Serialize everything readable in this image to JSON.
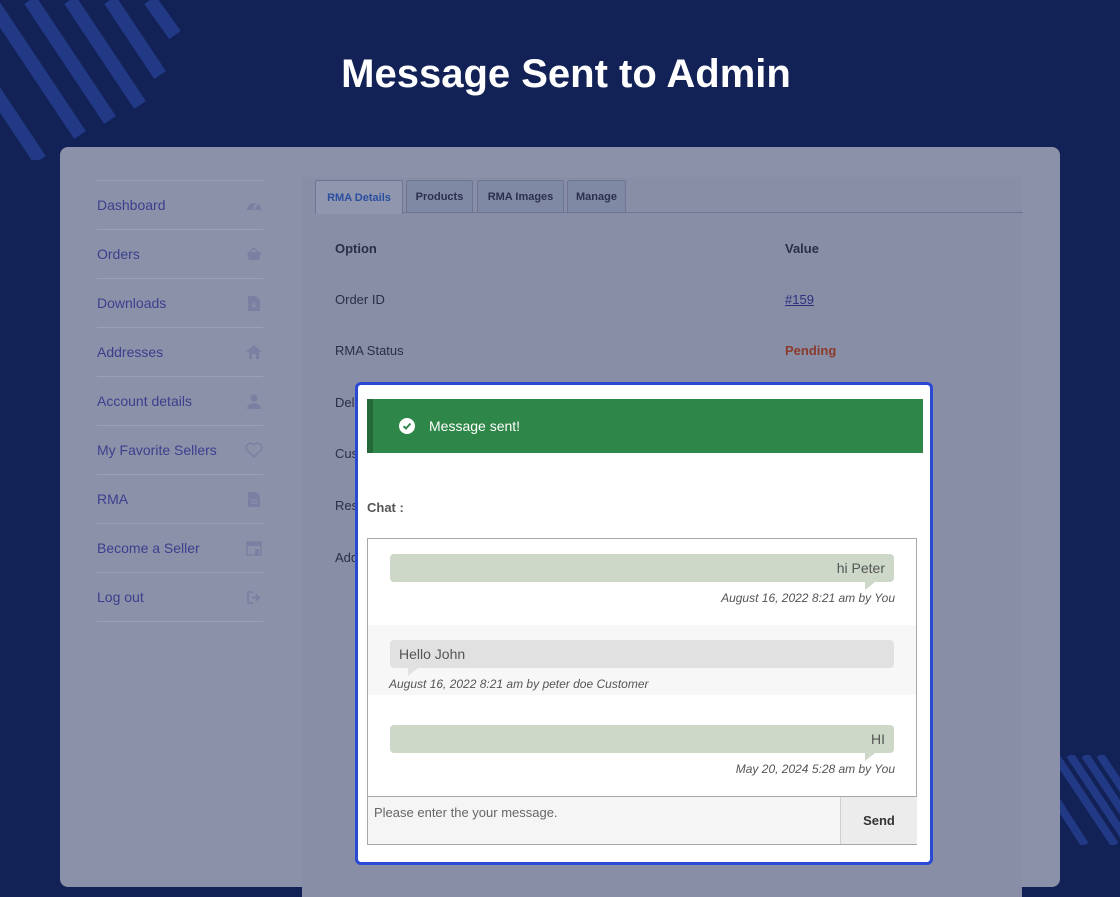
{
  "hero": {
    "title": "Message Sent to Admin"
  },
  "sidebar": {
    "items": [
      {
        "label": "Dashboard",
        "icon": "dashboard-icon"
      },
      {
        "label": "Orders",
        "icon": "basket-icon"
      },
      {
        "label": "Downloads",
        "icon": "file-download-icon"
      },
      {
        "label": "Addresses",
        "icon": "home-icon"
      },
      {
        "label": "Account details",
        "icon": "user-icon"
      },
      {
        "label": "My Favorite Sellers",
        "icon": "heart-icon"
      },
      {
        "label": "RMA",
        "icon": "document-icon"
      },
      {
        "label": "Become a Seller",
        "icon": "store-icon"
      },
      {
        "label": "Log out",
        "icon": "logout-icon"
      }
    ]
  },
  "tabs": [
    "RMA Details",
    "Products",
    "RMA Images",
    "Manage"
  ],
  "table": {
    "head": {
      "option": "Option",
      "value": "Value"
    },
    "rows": [
      {
        "option": "Order ID",
        "value": "#159"
      },
      {
        "option": "RMA Status",
        "value": "Pending"
      },
      {
        "option": "Del"
      },
      {
        "option": "Cus"
      },
      {
        "option": "Res"
      },
      {
        "option": "Add"
      }
    ]
  },
  "modal": {
    "alert": "Message sent!",
    "chat_label": "Chat :",
    "messages": [
      {
        "text": "hi Peter",
        "meta": "August 16, 2022 8:21 am by You",
        "from": "you"
      },
      {
        "text": "Hello John",
        "meta": "August 16, 2022 8:21 am by peter doe Customer",
        "from": "them"
      },
      {
        "text": "HI",
        "meta": "May 20, 2024 5:28 am by You",
        "from": "you"
      }
    ],
    "input_placeholder": "Please enter the your message.",
    "send_label": "Send"
  },
  "colors": {
    "background": "#132256",
    "alert_success": "#2e8648",
    "modal_border": "#2a4ad6",
    "bubble_you": "#cdd8c8",
    "bubble_them": "#e1e1e1",
    "status_pending": "#8c3a2c"
  }
}
